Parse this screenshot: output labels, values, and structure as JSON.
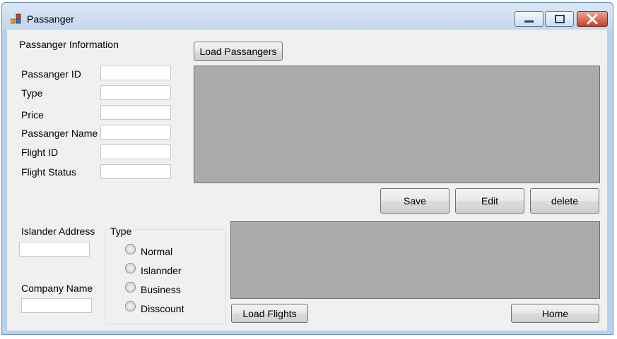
{
  "window": {
    "title": "Passanger"
  },
  "form": {
    "section_title": "Passanger Information",
    "fields": [
      {
        "label": "Passanger ID",
        "value": ""
      },
      {
        "label": "Type",
        "value": ""
      },
      {
        "label": "Price",
        "value": ""
      },
      {
        "label": "Passanger Name",
        "value": ""
      },
      {
        "label": "Flight ID",
        "value": ""
      },
      {
        "label": "Flight Status",
        "value": ""
      }
    ],
    "islander_address_label": "Islander Address",
    "islander_address_value": "",
    "company_name_label": "Company Name",
    "company_name_value": ""
  },
  "buttons": {
    "load_passangers": "Load Passangers",
    "save": "Save",
    "edit": "Edit",
    "delete": "delete",
    "load_flights": "Load Flights",
    "home": "Home"
  },
  "type_group": {
    "title": "Type",
    "options": [
      "Normal",
      "Islannder",
      "Business",
      "Disscount"
    ]
  },
  "colors": {
    "grid_background": "#ababab",
    "form_background": "#f0f0f0",
    "title_bar": "#c3d6ec",
    "close_button": "#c6402c"
  }
}
